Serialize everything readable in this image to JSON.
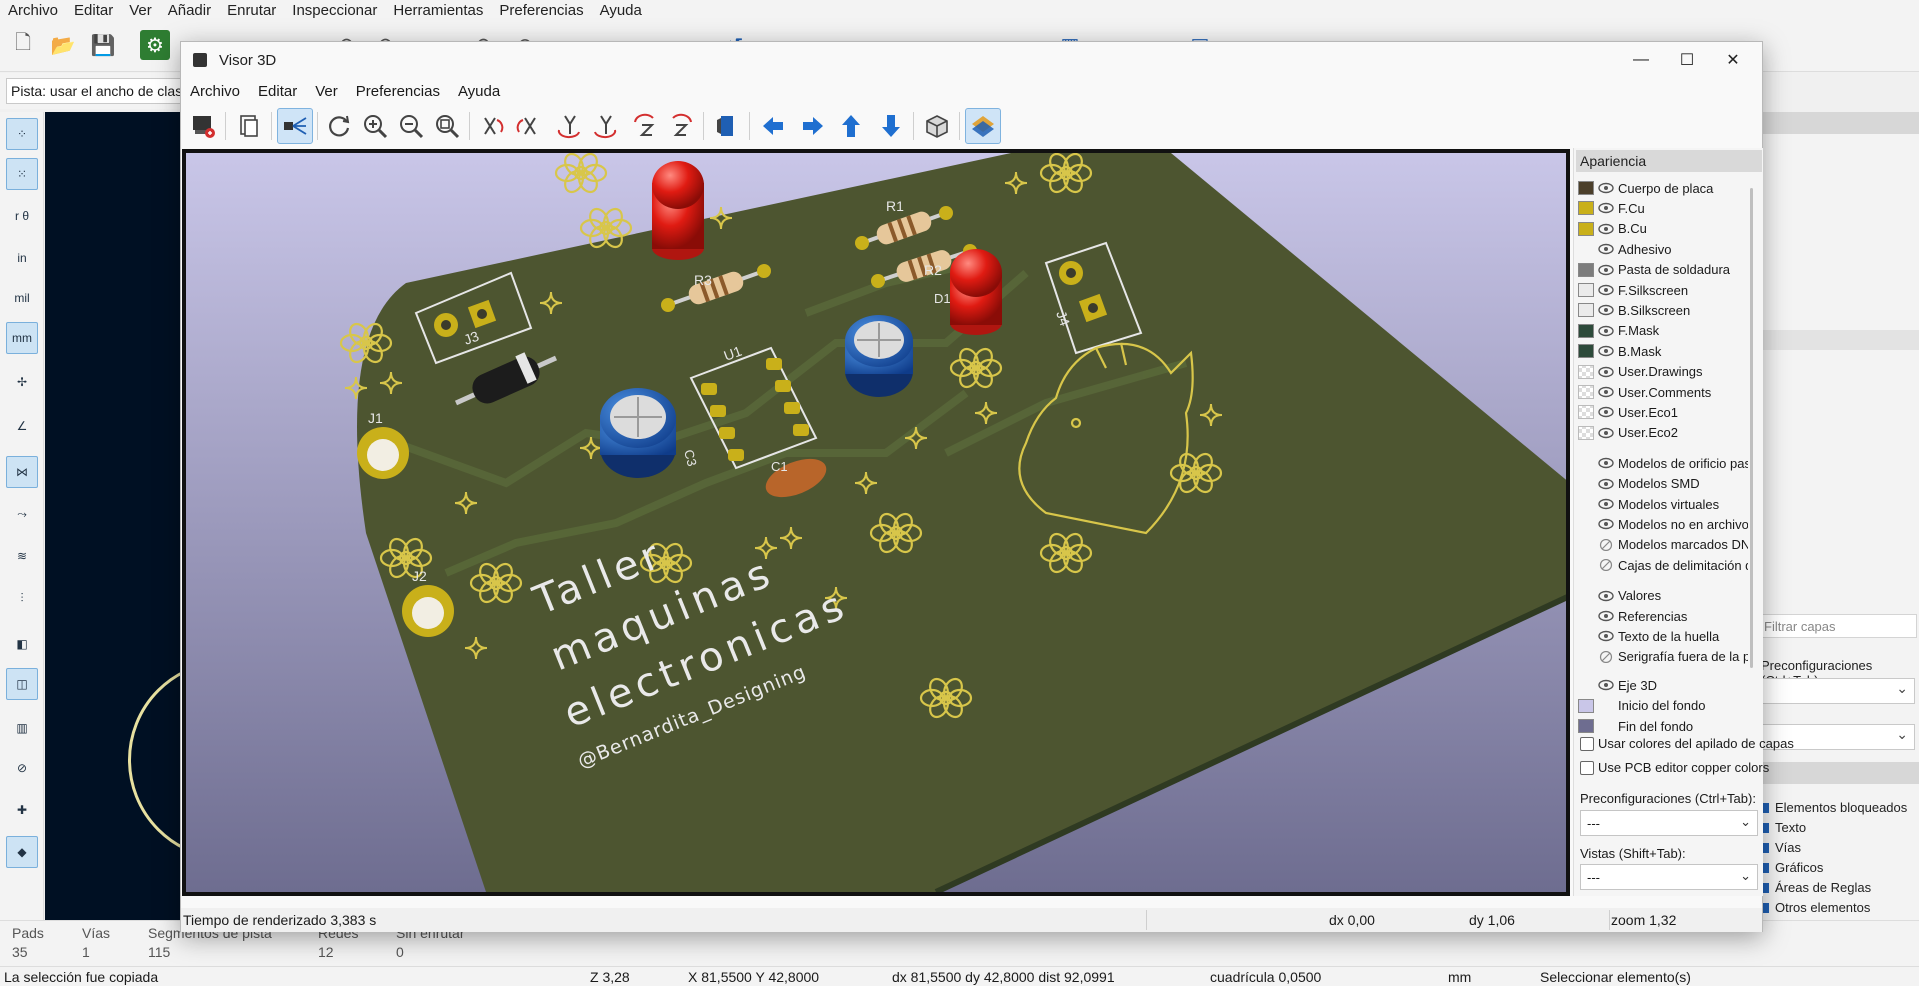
{
  "pcb_editor": {
    "menu": [
      "Archivo",
      "Editar",
      "Ver",
      "Añadir",
      "Enrutar",
      "Inspeccionar",
      "Herramientas",
      "Preferencias",
      "Ayuda"
    ],
    "track_combo": "Pista: usar el ancho de clase",
    "units": {
      "in": "in",
      "mil": "mil",
      "mm": "mm"
    },
    "message_panel": {
      "columns": [
        {
          "label": "Pads",
          "value": "35"
        },
        {
          "label": "Vías",
          "value": "1"
        },
        {
          "label": "Segmentos de pista",
          "value": "115"
        },
        {
          "label": "Redes",
          "value": "12"
        },
        {
          "label": "Sin enrutar",
          "value": "0"
        }
      ]
    },
    "status_bar": {
      "message": "La selección fue copiada",
      "z": "Z 3,28",
      "xy": "X 81,5500  Y 42,8000",
      "dxdy": "dx 81,5500  dy 42,8000  dist 92,0991",
      "grid": "cuadrícula 0,0500",
      "units": "mm",
      "mode": "Seleccionar elemento(s)"
    },
    "right_panel": {
      "filter_placeholder": "Filtrar capas",
      "preset_label": "Preconfiguraciones (Ctrl+Tab):",
      "visibility_items": [
        "Elementos bloqueados",
        "Texto",
        "Vías",
        "Gráficos",
        "Áreas de Reglas",
        "Otros elementos"
      ]
    }
  },
  "viewer": {
    "title": "Visor 3D",
    "window_controls": {
      "minimize": "—",
      "maximize": "☐",
      "close": "✕"
    },
    "menu": [
      "Archivo",
      "Editar",
      "Ver",
      "Preferencias",
      "Ayuda"
    ],
    "toolbar_icons": [
      "render-raytracing-icon",
      "copy-image-icon",
      "toggle-raytracing-icon",
      "refresh-icon",
      "zoom-in-icon",
      "zoom-out-icon",
      "zoom-fit-icon",
      "rotate-x-cw-icon",
      "rotate-x-ccw-icon",
      "rotate-y-cw-icon",
      "rotate-y-ccw-icon",
      "rotate-z-cw-icon",
      "rotate-z-ccw-icon",
      "flip-board-icon",
      "move-left-icon",
      "move-right-icon",
      "move-up-icon",
      "move-down-icon",
      "ortho-icon",
      "appearance-panel-icon"
    ],
    "appearance": {
      "header": "Apariencia",
      "layers": [
        {
          "name": "Cuerpo de placa",
          "color": "#4b3f2a"
        },
        {
          "name": "F.Cu",
          "color": "#c9b01a"
        },
        {
          "name": "B.Cu",
          "color": "#c9b01a"
        },
        {
          "name": "Adhesivo",
          "color": ""
        },
        {
          "name": "Pasta de soldadura",
          "color": "#7d7d7d"
        },
        {
          "name": "F.Silkscreen",
          "color": "#ebebeb"
        },
        {
          "name": "B.Silkscreen",
          "color": "#ebebeb"
        },
        {
          "name": "F.Mask",
          "color": "#2d4a3a"
        },
        {
          "name": "B.Mask",
          "color": "#2d4a3a"
        },
        {
          "name": "User.Drawings",
          "color": "checker"
        },
        {
          "name": "User.Comments",
          "color": "checker"
        },
        {
          "name": "User.Eco1",
          "color": "checker"
        },
        {
          "name": "User.Eco2",
          "color": "checker"
        }
      ],
      "models": [
        {
          "name": "Modelos de orificio pasante",
          "state": "eye"
        },
        {
          "name": "Modelos SMD",
          "state": "eye"
        },
        {
          "name": "Modelos virtuales",
          "state": "eye"
        },
        {
          "name": "Modelos no en archivos de posición",
          "state": "eye"
        },
        {
          "name": "Modelos marcados DNP",
          "state": "hidden"
        },
        {
          "name": "Cajas de delimitación del modelo",
          "state": "hidden"
        }
      ],
      "silk": [
        {
          "name": "Valores",
          "state": "eye"
        },
        {
          "name": "Referencias",
          "state": "eye"
        },
        {
          "name": "Texto de la huella",
          "state": "eye"
        },
        {
          "name": "Serigrafía fuera de la placa",
          "state": "hidden"
        }
      ],
      "misc": [
        {
          "name": "Eje 3D",
          "color": "",
          "state": "eye"
        },
        {
          "name": "Inicio del fondo",
          "color": "#c9c6e8",
          "state": ""
        },
        {
          "name": "Fin del fondo",
          "color": "#6e6d90",
          "state": ""
        }
      ],
      "checkbox_stackup": "Usar colores del apilado de capas",
      "checkbox_pcb_colors": "Use PCB editor copper colors",
      "presets_label": "Preconfiguraciones (Ctrl+Tab):",
      "presets_value": "---",
      "views_label": "Vistas (Shift+Tab):",
      "views_value": "---"
    },
    "status_bar": {
      "render_time": "Tiempo de renderizado 3,383 s",
      "dx": "dx 0,00",
      "dy": "dy 1,06",
      "zoom": "zoom 1,32"
    },
    "board": {
      "text_line1": "Taller",
      "text_line2": "maquinas",
      "text_line3": "electronicas",
      "credit": "@Bernardita_Designing",
      "refs": [
        "J1",
        "J2",
        "J3",
        "J4",
        "R1",
        "R2",
        "R3",
        "U1",
        "C1",
        "C3",
        "D1"
      ],
      "colors": {
        "mask": "#4d5530",
        "silk": "#d8c64a",
        "bg_top": "#c9c6e8",
        "bg_bottom": "#6e6d90"
      }
    }
  }
}
